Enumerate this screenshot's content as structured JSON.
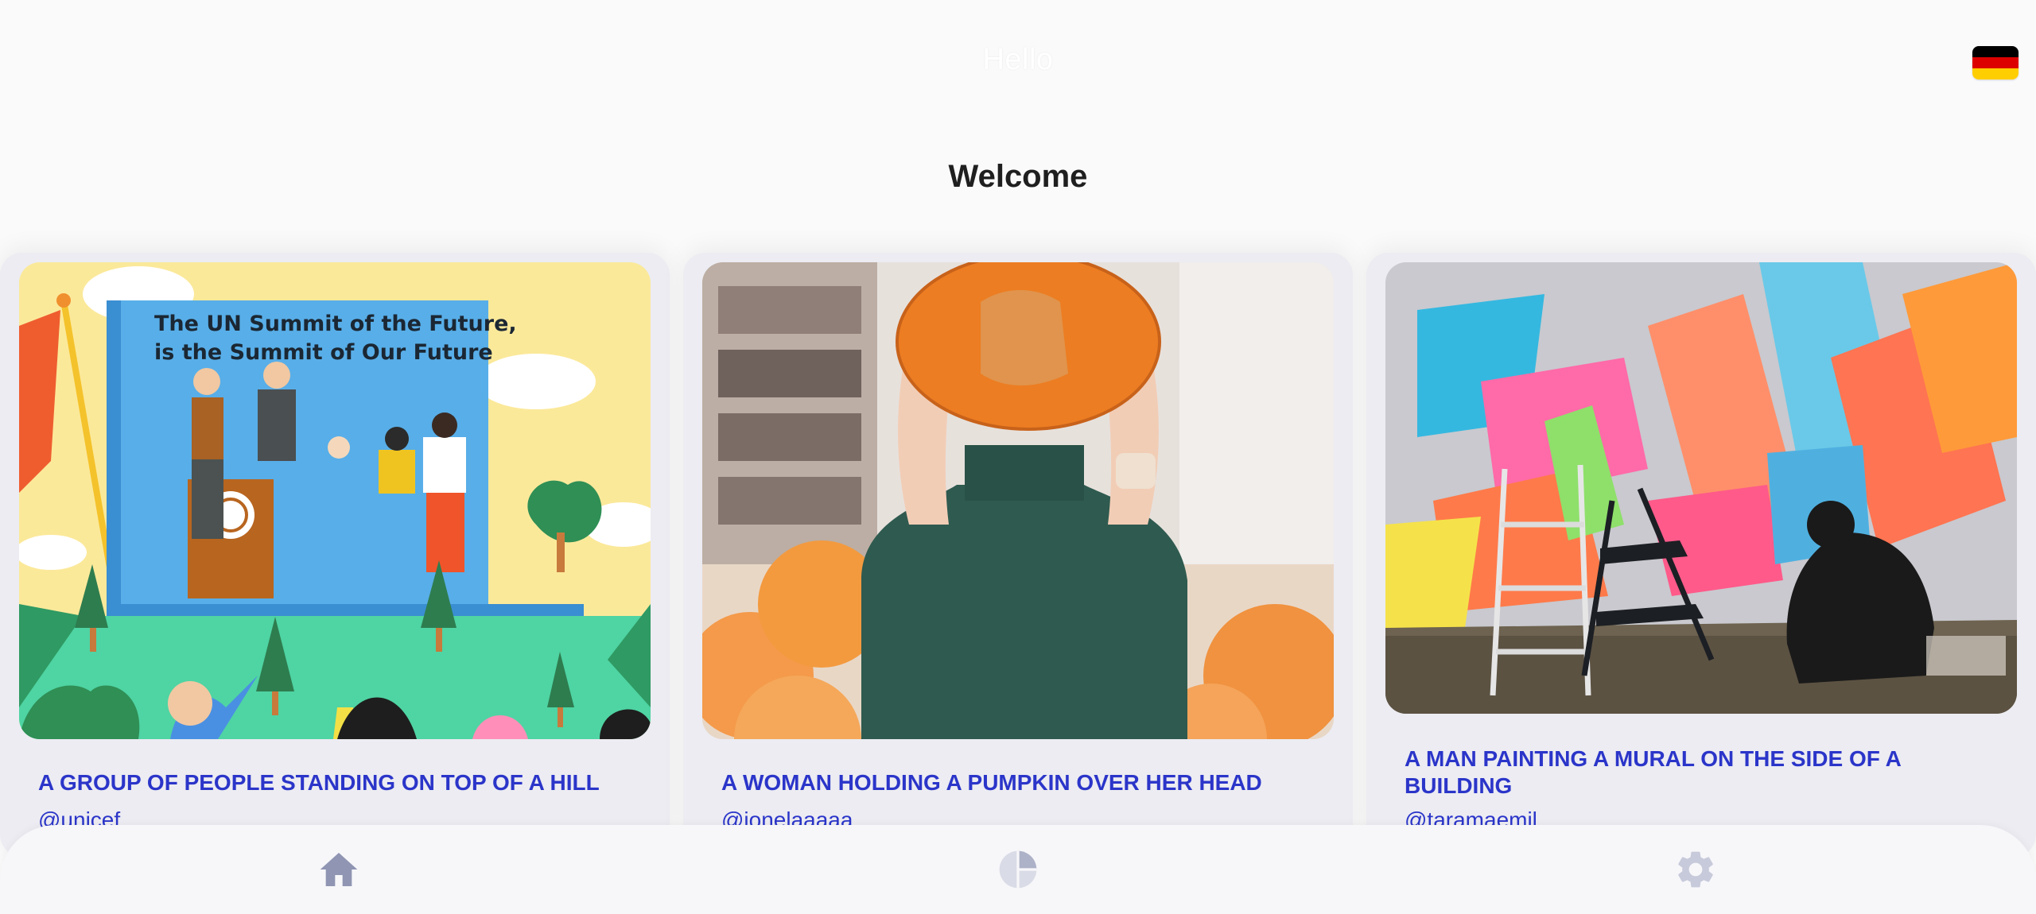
{
  "header": {
    "title": "Hello",
    "language_flag": "german-flag-icon",
    "flag_colors": [
      "#000000",
      "#dd0000",
      "#ffce00"
    ]
  },
  "main": {
    "heading": "Welcome",
    "cards": [
      {
        "title": "A GROUP OF PEOPLE STANDING ON TOP OF A HILL",
        "author": "@unicef",
        "image_text_line1": "The UN Summit of the Future,",
        "image_text_line2": "is the Summit of Our Future"
      },
      {
        "title": "A WOMAN HOLDING A PUMPKIN OVER HER HEAD",
        "author": "@ionelaaaaa"
      },
      {
        "title": "A MAN PAINTING A MURAL ON THE SIDE OF A BUILDING",
        "author": "@taramaemil"
      }
    ]
  },
  "bottom_nav": {
    "items": [
      "home-icon",
      "chart-pie-icon",
      "gear-icon"
    ],
    "icon_color": "#8f95b2"
  },
  "colors": {
    "accent": "#2b35c9",
    "background": "#fafafa",
    "card_background": "#ececf2"
  }
}
